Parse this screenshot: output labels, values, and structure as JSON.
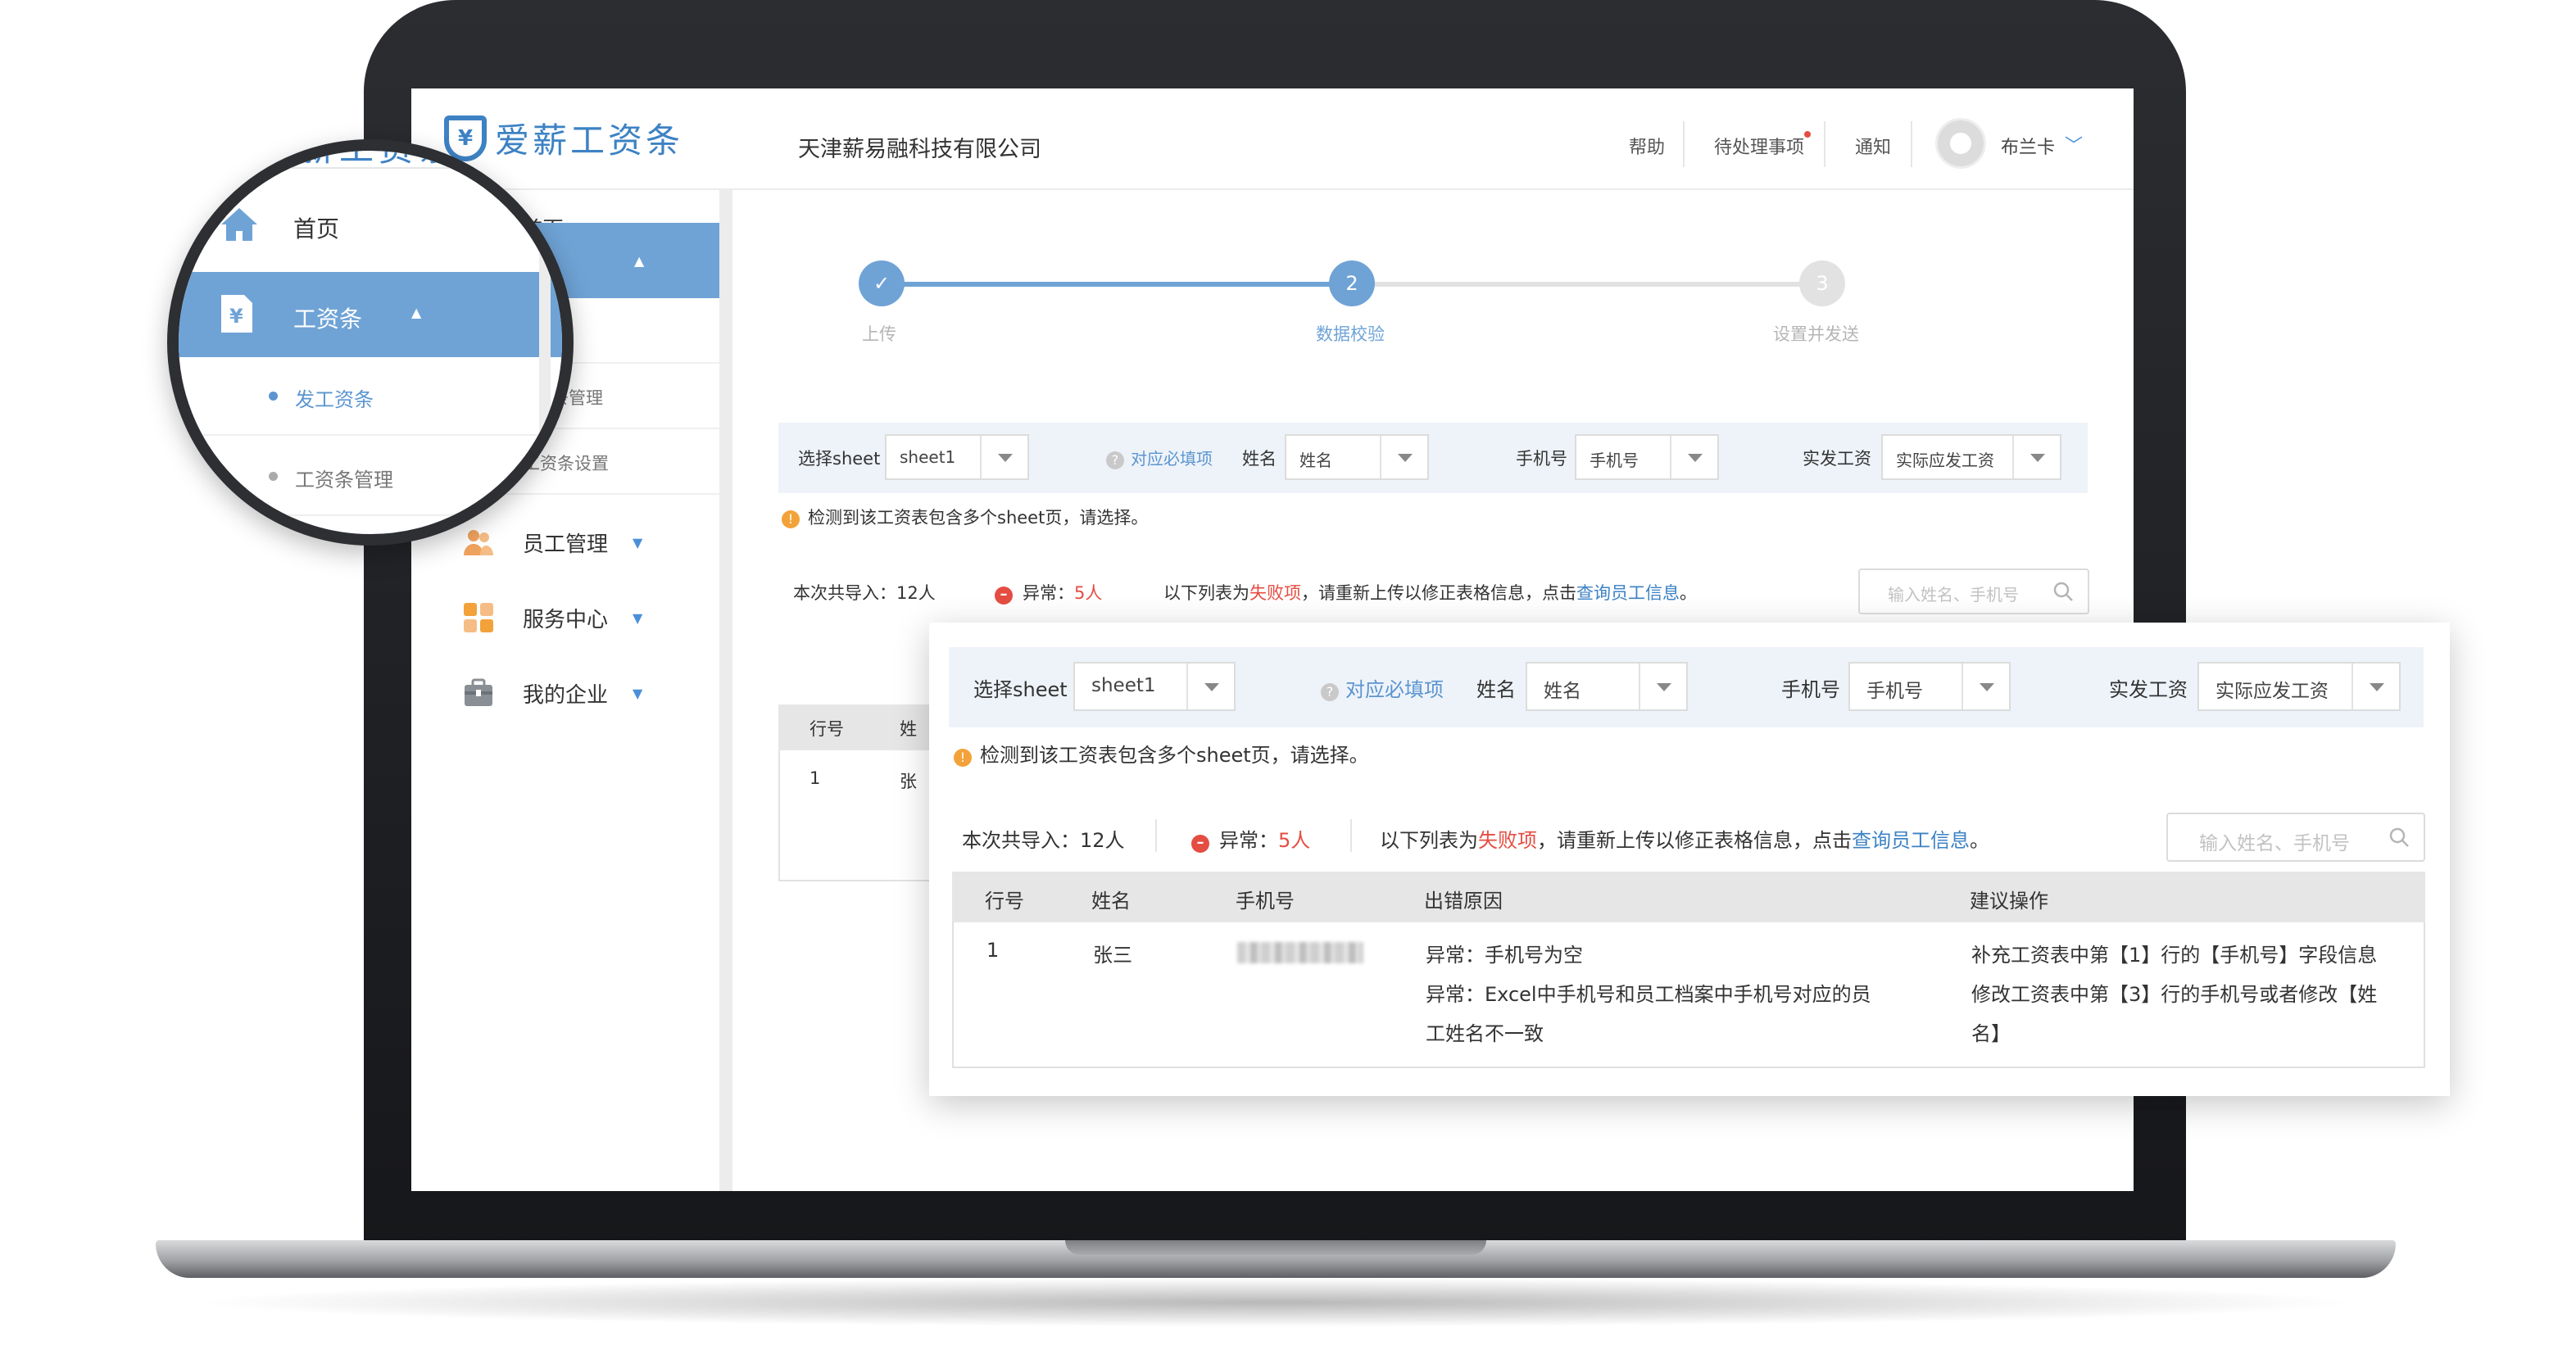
{
  "app": {
    "logo_text": "爱薪工资条",
    "logo_symbol": "¥",
    "company": "天津薪易融科技有限公司"
  },
  "header": {
    "help": "帮助",
    "pending": "待处理事项",
    "notify": "通知",
    "user_name": "布兰卡",
    "user_chevron": "﹀"
  },
  "sidebar": {
    "home": "首页",
    "payslip": "工资条",
    "payslip_sub": [
      "发工资条",
      "工资条管理",
      "工资条设置"
    ],
    "staff": "员工管理",
    "service": "服务中心",
    "enterprise": "我的企业",
    "partial": {
      "home": "首页",
      "payslip": "条",
      "send": "资条",
      "manage": "资条管理"
    }
  },
  "steps": [
    {
      "num": "✓",
      "label": "上传"
    },
    {
      "num": "2",
      "label": "数据校验"
    },
    {
      "num": "3",
      "label": "设置并发送"
    }
  ],
  "filter": {
    "sheet_label": "选择sheet",
    "sheet_value": "sheet1",
    "help_link": "对应必填项",
    "name_label": "姓名",
    "name_value": "姓名",
    "phone_label": "手机号",
    "phone_value": "手机号",
    "salary_label": "实发工资",
    "salary_value": "实际应发工资",
    "help_icon": "?"
  },
  "notice": {
    "warn_icon": "!",
    "multi_sheet": "检测到该工资表包含多个sheet页，请选择。"
  },
  "summary": {
    "imported": "本次共导入：12人",
    "abnormal_prefix": "异常：",
    "abnormal_count": "5人",
    "err_icon": "–",
    "hint_prefix": "以下列表为",
    "hint_fail": "失败项",
    "hint_mid": "，请重新上传以修正表格信息，点击",
    "hint_link": "查询员工信息",
    "hint_end": "。",
    "search_placeholder": "输入姓名、手机号"
  },
  "table": {
    "headers": [
      "行号",
      "姓名",
      "手机号",
      "出错原因",
      "建议操作"
    ],
    "partial_name_header": "姓",
    "partial_name_cell": "张",
    "rows": [
      {
        "row": "1",
        "name": "张三",
        "errors": [
          "异常：手机号为空",
          "异常：Excel中手机号和员工档案中手机号对应的员",
          "工姓名不一致"
        ],
        "actions": [
          "补充工资表中第【1】行的【手机号】字段信息",
          "修改工资表中第【3】行的手机号或者修改【姓",
          "名】"
        ]
      }
    ]
  }
}
